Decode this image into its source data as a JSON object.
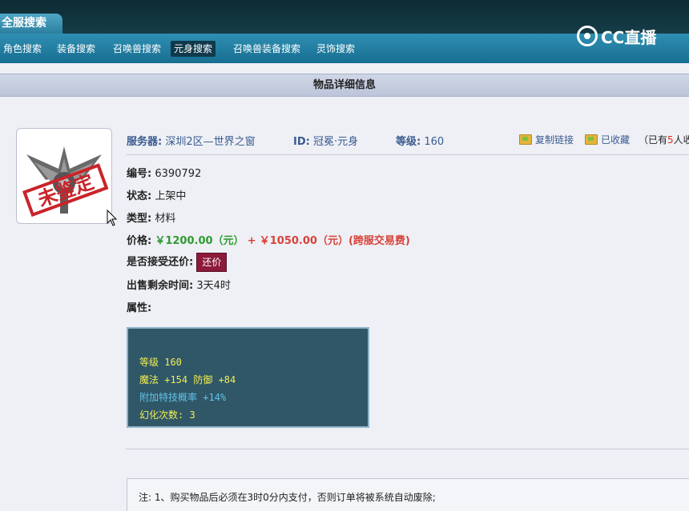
{
  "header": {
    "tab_title": "全服搜索",
    "nav": [
      "角色搜索",
      "装备搜索",
      "召唤兽搜索",
      "元身搜索",
      "召唤兽装备搜索",
      "灵饰搜索"
    ],
    "active_nav_index": 3,
    "logo_text": "CC直播"
  },
  "section_title": "物品详细信息",
  "item": {
    "image_text": "未鉴定",
    "server_label": "服务器:",
    "server_value": "深圳2区—世界之窗",
    "id_label": "ID:",
    "id_value": "冠冕·元身",
    "level_label": "等级:",
    "level_value": "160",
    "copy_link": "复制链接",
    "favorited": "已收藏",
    "fav_prefix": "（已有",
    "fav_count": "5",
    "fav_suffix": "人收藏"
  },
  "details": {
    "number_label": "编号:",
    "number_value": "6390792",
    "status_label": "状态:",
    "status_value": "上架中",
    "type_label": "类型:",
    "type_value": "材料",
    "price_label": "价格:",
    "price_main": "￥1200.00（元）",
    "price_plus": "+",
    "price_fee": "￥1050.00（元）(跨服交易费)",
    "bargain_label": "是否接受还价:",
    "bargain_button": "还价",
    "time_left_label": "出售剩余时间:",
    "time_left_value": "3天4时",
    "attr_label": "属性:"
  },
  "attributes": {
    "level": "等级 160",
    "stats": "魔法 +154 防御 +84",
    "skill_rate": "附加特技概率 +14%",
    "transform_count": "幻化次数: 3"
  },
  "notes": {
    "line1": "注: 1、购买物品后必须在3时0分内支付，否则订单将被系统自动废除;"
  },
  "colors": {
    "nav_bg": "#176e91",
    "link_blue": "#3a5a8f",
    "price_green": "#2f9a2f",
    "price_red": "#d8423a",
    "attr_bg": "#2f5768",
    "attr_yellow": "#f2ee52",
    "attr_blue": "#62c3e8"
  }
}
